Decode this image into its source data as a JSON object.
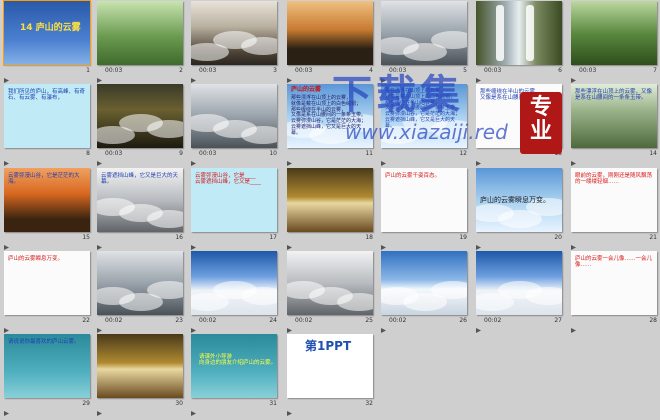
{
  "app": {
    "title": "Slide Sorter"
  },
  "slides": [
    {
      "num": "1",
      "time": "",
      "title": "14 庐山的云雾",
      "subtitle": "",
      "lines": []
    },
    {
      "num": "2",
      "time": "00:03",
      "title": "",
      "lines": []
    },
    {
      "num": "3",
      "time": "00:03",
      "title": "",
      "lines": []
    },
    {
      "num": "4",
      "time": "00:03",
      "title": "",
      "lines": []
    },
    {
      "num": "5",
      "time": "00:03",
      "title": "",
      "lines": []
    },
    {
      "num": "6",
      "time": "00:03",
      "title": "",
      "lines": []
    },
    {
      "num": "7",
      "time": "00:03",
      "title": "",
      "lines": []
    },
    {
      "num": "8",
      "time": "",
      "title": "",
      "lines": [
        "我们所见的庐山，有高峰、有奇石、有云雾、有瀑布，"
      ]
    },
    {
      "num": "9",
      "time": "00:03",
      "title": "",
      "lines": []
    },
    {
      "num": "10",
      "time": "00:03",
      "title": "",
      "lines": []
    },
    {
      "num": "11",
      "time": "",
      "title": "庐山的云雾",
      "lines": [
        "那些漂浮在山顶上的云雾，",
        "就像是戴在山顶上的白色绒帽；",
        "那些缠绕在半山的云雾，",
        "又像是系在山腰间的一条条玉带。",
        "云雾弥漫山谷，它是茫茫的大海；",
        "云雾遮挡山峰，它又是巨大的天幕。"
      ]
    },
    {
      "num": "12",
      "time": "",
      "title": "",
      "lines": [
        "那些漂浮在山顶上的云雾，",
        "就像是戴在山顶上的白色绒帽；",
        "那些缠绕在半山的云雾，",
        "又像是系在山腰间的一条条玉带。",
        "云雾弥漫山谷，它是茫茫的大海；",
        "云雾遮挡山峰，它又是巨大的天幕。"
      ]
    },
    {
      "num": "13",
      "time": "",
      "title": "",
      "lines": [
        "那些缠绕在半山的云雾",
        "又像是系在山腰间的"
      ]
    },
    {
      "num": "14",
      "time": "",
      "title": "",
      "lines": [
        "那些漂浮在山顶上的云雾，又像是系在山腰间的一条条玉带。"
      ]
    },
    {
      "num": "15",
      "time": "",
      "title": "",
      "lines": [
        "云雾弥漫山谷，它是茫茫的大海。"
      ]
    },
    {
      "num": "16",
      "time": "",
      "title": "",
      "lines": [
        "云雾遮挡山峰，它又是巨大的天幕。"
      ]
    },
    {
      "num": "17",
      "time": "",
      "title": "",
      "lines": [
        "云雾弥漫山谷，它是____",
        "云雾遮挡山峰，它又是____"
      ]
    },
    {
      "num": "18",
      "time": "",
      "title": "",
      "lines": []
    },
    {
      "num": "19",
      "time": "",
      "title": "",
      "lines": [
        "庐山的云雾千姿百态。"
      ]
    },
    {
      "num": "20",
      "time": "",
      "title": "",
      "lines": [
        "庐山的云雾瞬息万变。"
      ]
    },
    {
      "num": "21",
      "time": "",
      "title": "",
      "lines": [
        "眼前的云雾，刚刚还是随风飘荡的一缕缕轻烟……"
      ]
    },
    {
      "num": "22",
      "time": "",
      "title": "",
      "lines": [
        "庐山的云雾瞬息万变。"
      ]
    },
    {
      "num": "23",
      "time": "00:02",
      "title": "",
      "lines": []
    },
    {
      "num": "24",
      "time": "00:02",
      "title": "",
      "lines": []
    },
    {
      "num": "25",
      "time": "00:02",
      "title": "",
      "lines": []
    },
    {
      "num": "26",
      "time": "00:02",
      "title": "",
      "lines": []
    },
    {
      "num": "27",
      "time": "00:02",
      "title": "",
      "lines": []
    },
    {
      "num": "28",
      "time": "",
      "title": "",
      "lines": [
        "庐山的云雾一会儿像……一会儿像……"
      ]
    },
    {
      "num": "29",
      "time": "",
      "title": "",
      "lines": [
        "请说说你最喜欢的庐山云雾。"
      ]
    },
    {
      "num": "30",
      "time": "",
      "title": "",
      "lines": []
    },
    {
      "num": "31",
      "time": "",
      "title": "",
      "lines": [
        "请课外小导游",
        "向身边的朋友介绍庐山的云雾。"
      ]
    },
    {
      "num": "32",
      "time": "",
      "title": "第1PPT",
      "lines": []
    }
  ],
  "watermark": {
    "main": "下载集",
    "sub": "www.xiazaiji.red",
    "seal": "专业"
  },
  "colors": {
    "accent": "#ff9c00",
    "text_red": "#d81818",
    "text_blue": "#1f3fb0",
    "watermark": "#2846be",
    "seal": "#b01818"
  }
}
